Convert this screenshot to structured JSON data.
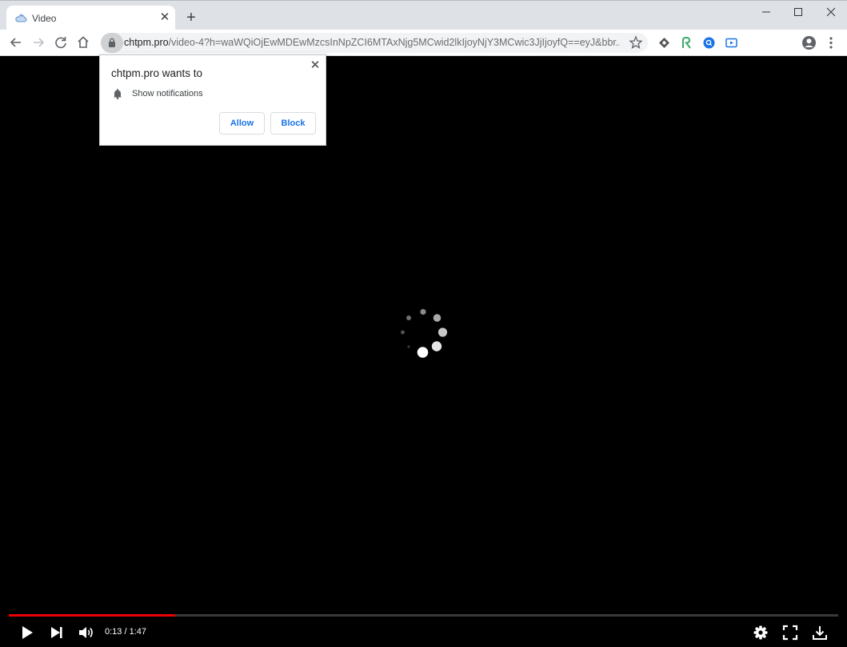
{
  "browser": {
    "tab": {
      "title": "Video",
      "close_glyph": "✕",
      "favicon": "cloud-icon"
    },
    "new_tab_glyph": "+",
    "window_controls": [
      "minimize-icon",
      "maximize-icon",
      "close-icon"
    ],
    "toolbar": {
      "back": "arrow-left-icon",
      "forward": "arrow-right-icon",
      "reload": "reload-icon",
      "home": "home-icon",
      "url_host": "chtpm.pro",
      "url_path": "/video-4?h=waWQiOjEwMDEwMzcsInNpZCI6MTAxNjg5MCwid2lkIjoyNjY3MCwic3JjIjoyfQ==eyJ&bbr...",
      "extensions": [
        "diamond-extension-icon",
        "r-extension-icon",
        "blue-circle-extension-icon",
        "video-extension-icon"
      ]
    }
  },
  "permission_prompt": {
    "title": "chtpm.pro wants to",
    "permission": "Show notifications",
    "allow_label": "Allow",
    "block_label": "Block",
    "close_glyph": "✕"
  },
  "player": {
    "time": "0:13 / 1:47",
    "progress_fraction": 0.201,
    "loading": true,
    "accent_color": "#ee0000"
  }
}
